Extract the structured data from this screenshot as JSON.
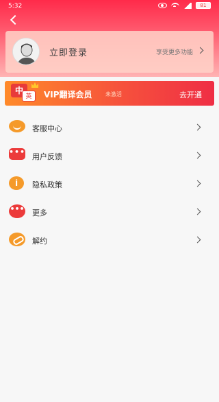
{
  "status_bar": {
    "time": "5:32",
    "battery": "81"
  },
  "header": {
    "back_icon": "chevron-left-icon"
  },
  "login_card": {
    "title": "立即登录",
    "subtitle": "享受更多功能"
  },
  "vip": {
    "logo_zh": "中",
    "logo_en": "英",
    "title": "VIP翻译会员",
    "status": "未激活",
    "action": "去开通"
  },
  "menu": {
    "items": [
      {
        "label": "客服中心",
        "icon": "headset-icon"
      },
      {
        "label": "用户反馈",
        "icon": "chat-icon"
      },
      {
        "label": "隐私政策",
        "icon": "info-icon"
      },
      {
        "label": "更多",
        "icon": "more-icon"
      },
      {
        "label": "解约",
        "icon": "link-icon"
      }
    ]
  },
  "colors": {
    "brand_red": "#ff2a4a",
    "accent_orange": "#f59a2a",
    "accent_red": "#ec3b3b"
  }
}
